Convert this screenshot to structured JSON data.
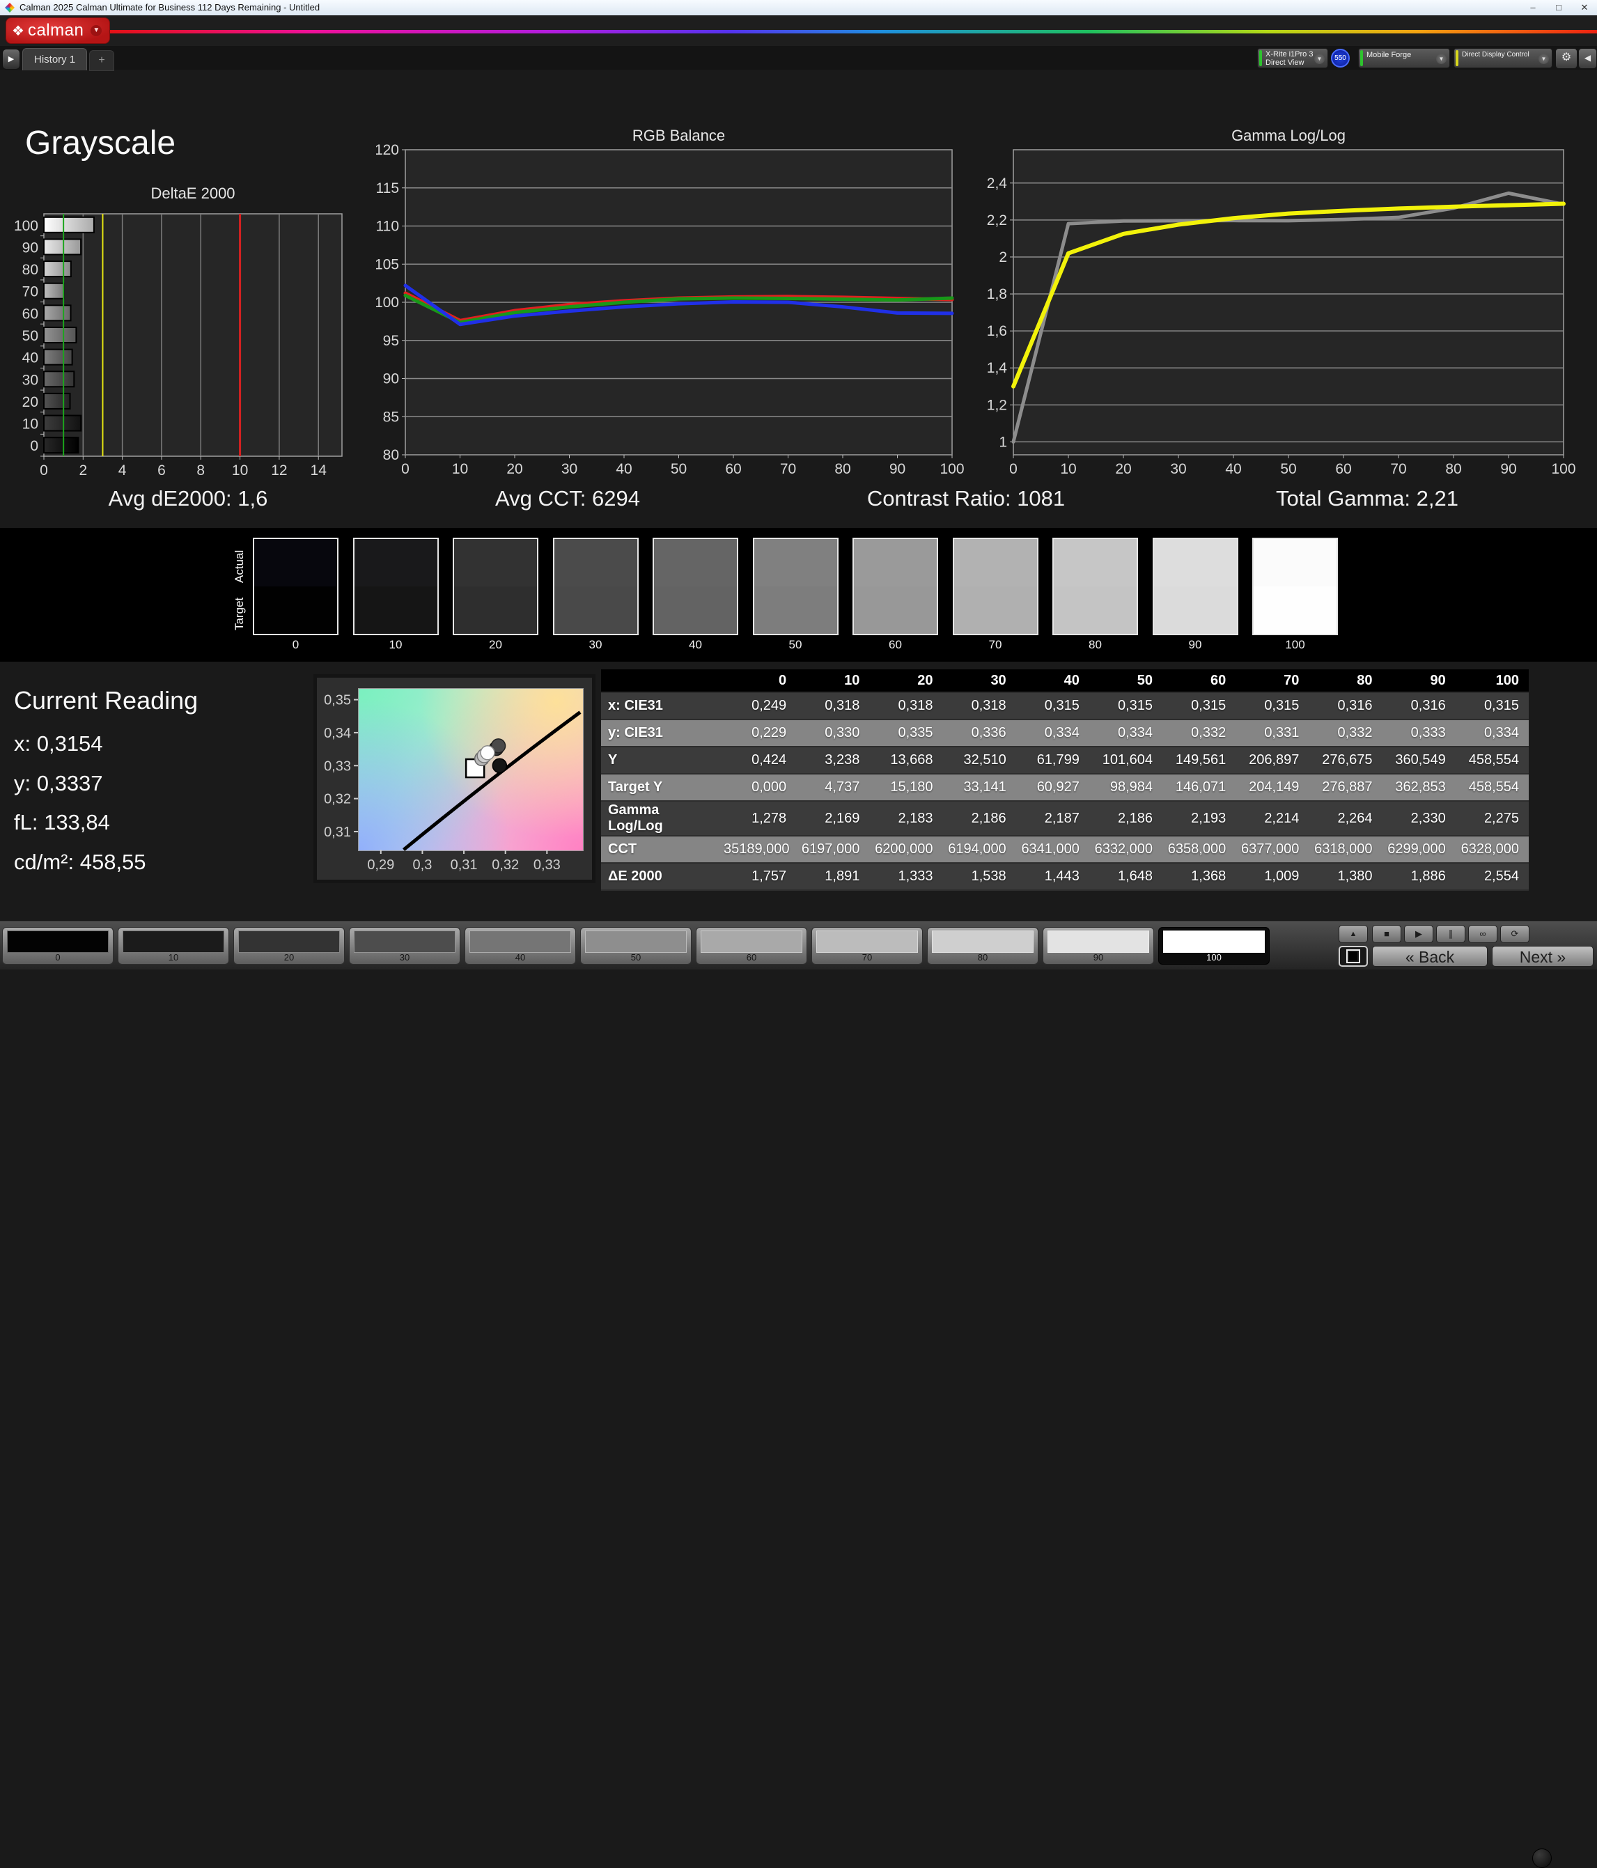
{
  "window": {
    "title": "Calman 2025 Calman Ultimate for Business 112 Days Remaining  - Untitled",
    "controls": {
      "minimize": "–",
      "maximize": "□",
      "close": "✕"
    }
  },
  "logo": {
    "wordmark": "calman",
    "diamond_icon": "❖",
    "caret": "▼"
  },
  "tabrow": {
    "scroll_icon": "▶",
    "history_tab": "History 1",
    "add_tab": "+",
    "meter": {
      "line1": "X-Rite i1Pro 3",
      "line2": "Direct View",
      "badge": "550",
      "stripe": "#2ec22e"
    },
    "source": {
      "label": "Mobile Forge",
      "stripe": "#2ec22e"
    },
    "display_control": {
      "label": "Direct Display Control",
      "stripe": "#d8d81c"
    },
    "gear_icon": "⚙",
    "collapse_icon": "◀"
  },
  "page": {
    "title": "Grayscale"
  },
  "summary": {
    "avg_de": "Avg dE2000: 1,6",
    "avg_cct": "Avg CCT: 6294",
    "contrast": "Contrast Ratio: 1081",
    "total_gamma": "Total Gamma: 2,21"
  },
  "chart_data": [
    {
      "type": "bar",
      "orientation": "horizontal",
      "title": "DeltaE 2000",
      "categories": [
        "100",
        "90",
        "80",
        "70",
        "60",
        "50",
        "40",
        "30",
        "20",
        "10",
        "0"
      ],
      "values": [
        2.554,
        1.886,
        1.38,
        1.009,
        1.368,
        1.648,
        1.443,
        1.538,
        1.333,
        1.891,
        1.757
      ],
      "levels": [
        100,
        90,
        80,
        70,
        60,
        50,
        40,
        30,
        20,
        10,
        0
      ],
      "xlim": [
        0,
        15.2
      ],
      "xticks": [
        {
          "v": 0,
          "label": "0"
        },
        {
          "v": 2,
          "label": "2"
        },
        {
          "v": 4,
          "label": "4"
        },
        {
          "v": 6,
          "label": "6"
        },
        {
          "v": 8,
          "label": "8"
        },
        {
          "v": 10,
          "label": "10"
        },
        {
          "v": 12,
          "label": "12"
        },
        {
          "v": 14,
          "label": "14"
        }
      ],
      "reference_lines": [
        {
          "v": 1,
          "color": "#1ca51c",
          "w": 2
        },
        {
          "v": 3,
          "color": "#e6e612",
          "w": 2
        },
        {
          "v": 10,
          "color": "#d42020",
          "w": 3
        }
      ],
      "grid": true
    },
    {
      "type": "line",
      "title": "RGB Balance",
      "x": [
        0,
        10,
        20,
        30,
        40,
        50,
        60,
        70,
        80,
        90,
        100
      ],
      "xlim": [
        0,
        100
      ],
      "xticks": [
        {
          "v": 0,
          "label": "0"
        },
        {
          "v": 10,
          "label": "10"
        },
        {
          "v": 20,
          "label": "20"
        },
        {
          "v": 30,
          "label": "30"
        },
        {
          "v": 40,
          "label": "40"
        },
        {
          "v": 50,
          "label": "50"
        },
        {
          "v": 60,
          "label": "60"
        },
        {
          "v": 70,
          "label": "70"
        },
        {
          "v": 80,
          "label": "80"
        },
        {
          "v": 90,
          "label": "90"
        },
        {
          "v": 100,
          "label": "100"
        }
      ],
      "ylim": [
        80,
        120
      ],
      "yticks": [
        {
          "v": 80,
          "label": "80"
        },
        {
          "v": 85,
          "label": "85"
        },
        {
          "v": 90,
          "label": "90"
        },
        {
          "v": 95,
          "label": "95"
        },
        {
          "v": 100,
          "label": "100"
        },
        {
          "v": 105,
          "label": "105"
        },
        {
          "v": 110,
          "label": "110"
        },
        {
          "v": 115,
          "label": "115"
        },
        {
          "v": 120,
          "label": "120"
        }
      ],
      "series": [
        {
          "name": "red",
          "color": "#e02020",
          "width": 5,
          "values": [
            101.2,
            97.6,
            98.9,
            99.7,
            100.2,
            100.55,
            100.7,
            100.75,
            100.65,
            100.5,
            100.35
          ]
        },
        {
          "name": "green",
          "color": "#189818",
          "width": 5,
          "values": [
            100.9,
            97.35,
            98.65,
            99.4,
            100.0,
            100.45,
            100.55,
            100.5,
            100.4,
            100.3,
            100.55
          ]
        },
        {
          "name": "blue",
          "color": "#2030e8",
          "width": 5,
          "values": [
            102.2,
            97.1,
            98.2,
            98.85,
            99.4,
            99.8,
            100.05,
            100.0,
            99.4,
            98.6,
            98.55
          ]
        }
      ]
    },
    {
      "type": "line",
      "title": "Gamma Log/Log",
      "x": [
        0,
        10,
        20,
        30,
        40,
        50,
        60,
        70,
        80,
        90,
        100
      ],
      "xlim": [
        0,
        100
      ],
      "xticks": [
        {
          "v": 0,
          "label": "0"
        },
        {
          "v": 10,
          "label": "10"
        },
        {
          "v": 20,
          "label": "20"
        },
        {
          "v": 30,
          "label": "30"
        },
        {
          "v": 40,
          "label": "40"
        },
        {
          "v": 50,
          "label": "50"
        },
        {
          "v": 60,
          "label": "60"
        },
        {
          "v": 70,
          "label": "70"
        },
        {
          "v": 80,
          "label": "80"
        },
        {
          "v": 90,
          "label": "90"
        },
        {
          "v": 100,
          "label": "100"
        }
      ],
      "ylim": [
        0.93,
        2.58
      ],
      "yticks": [
        {
          "v": 1,
          "label": "1"
        },
        {
          "v": 1.2,
          "label": "1,2"
        },
        {
          "v": 1.4,
          "label": "1,4"
        },
        {
          "v": 1.6,
          "label": "1,6"
        },
        {
          "v": 1.8,
          "label": "1,8"
        },
        {
          "v": 2,
          "label": "2"
        },
        {
          "v": 2.2,
          "label": "2,2"
        },
        {
          "v": 2.4,
          "label": "2,4"
        }
      ],
      "series": [
        {
          "name": "measured",
          "color": "#8d8d8d",
          "width": 5,
          "values": [
            1.0,
            2.18,
            2.195,
            2.196,
            2.197,
            2.196,
            2.203,
            2.214,
            2.264,
            2.345,
            2.285
          ]
        },
        {
          "name": "target",
          "color": "#f2f20a",
          "width": 6,
          "values": [
            1.3,
            2.02,
            2.125,
            2.175,
            2.21,
            2.235,
            2.25,
            2.262,
            2.272,
            2.28,
            2.288
          ]
        }
      ]
    },
    {
      "type": "scatter",
      "title": "CIE chromaticity",
      "xlim": [
        0.2845,
        0.3385
      ],
      "ylim": [
        0.3045,
        0.3535
      ],
      "xticks": [
        {
          "v": 0.29,
          "label": "0,29"
        },
        {
          "v": 0.3,
          "label": "0,3"
        },
        {
          "v": 0.31,
          "label": "0,31"
        },
        {
          "v": 0.32,
          "label": "0,32"
        },
        {
          "v": 0.33,
          "label": "0,33"
        }
      ],
      "yticks": [
        {
          "v": 0.31,
          "label": "0,31"
        },
        {
          "v": 0.32,
          "label": "0,32"
        },
        {
          "v": 0.33,
          "label": "0,33"
        },
        {
          "v": 0.34,
          "label": "0,34"
        },
        {
          "v": 0.35,
          "label": "0,35"
        }
      ],
      "locus": {
        "from": [
          0.2955,
          0.3045
        ],
        "ctrl": [
          0.3175,
          0.3272
        ],
        "to": [
          0.338,
          0.3462
        ]
      },
      "target_square": {
        "x": 0.3127,
        "y": 0.3292
      },
      "points": [
        {
          "x": 0.3186,
          "y": 0.33,
          "fill": "#151515",
          "stroke": "#000"
        },
        {
          "x": 0.3178,
          "y": 0.3352,
          "fill": "#383838,",
          "stroke": "#111"
        },
        {
          "x": 0.3183,
          "y": 0.336,
          "fill": "#4a4a4a",
          "stroke": "#222"
        },
        {
          "x": 0.3143,
          "y": 0.3321,
          "fill": "#b8b8b8",
          "stroke": "#666"
        },
        {
          "x": 0.3149,
          "y": 0.333,
          "fill": "#cfcfcf",
          "stroke": "#777"
        },
        {
          "x": 0.3157,
          "y": 0.3339,
          "fill": "#fdfdfd",
          "stroke": "#888"
        }
      ]
    }
  ],
  "grayscale_strip": {
    "row_labels": [
      "Actual",
      "Target"
    ],
    "steps": [
      {
        "label": "0",
        "actual": "#07070d",
        "target": "#010101"
      },
      {
        "label": "10",
        "actual": "#19191b",
        "target": "#151515"
      },
      {
        "label": "20",
        "actual": "#323232",
        "target": "#2e2e2e"
      },
      {
        "label": "30",
        "actual": "#4b4b4b",
        "target": "#494949"
      },
      {
        "label": "40",
        "actual": "#656565",
        "target": "#636363"
      },
      {
        "label": "50",
        "actual": "#808080",
        "target": "#7d7d7d"
      },
      {
        "label": "60",
        "actual": "#9a9a9a",
        "target": "#989898"
      },
      {
        "label": "70",
        "actual": "#b2b2b2",
        "target": "#b0b0b0"
      },
      {
        "label": "80",
        "actual": "#c6c6c6",
        "target": "#c4c4c4"
      },
      {
        "label": "90",
        "actual": "#dddddd",
        "target": "#dbdbdb"
      },
      {
        "label": "100",
        "actual": "#fbfbfb",
        "target": "#fefefe"
      }
    ]
  },
  "current_reading": {
    "title": "Current Reading",
    "lines": [
      "x: 0,3154",
      "y: 0,3337",
      "fL: 133,84",
      "cd/m²: 458,55"
    ]
  },
  "table": {
    "columns": [
      "0",
      "10",
      "20",
      "30",
      "40",
      "50",
      "60",
      "70",
      "80",
      "90",
      "100"
    ],
    "rows": [
      {
        "label": "x: CIE31",
        "values": [
          "0,249",
          "0,318",
          "0,318",
          "0,318",
          "0,315",
          "0,315",
          "0,315",
          "0,315",
          "0,316",
          "0,316",
          "0,315"
        ]
      },
      {
        "label": "y: CIE31",
        "values": [
          "0,229",
          "0,330",
          "0,335",
          "0,336",
          "0,334",
          "0,334",
          "0,332",
          "0,331",
          "0,332",
          "0,333",
          "0,334"
        ]
      },
      {
        "label": "Y",
        "values": [
          "0,424",
          "3,238",
          "13,668",
          "32,510",
          "61,799",
          "101,604",
          "149,561",
          "206,897",
          "276,675",
          "360,549",
          "458,554"
        ]
      },
      {
        "label": "Target Y",
        "values": [
          "0,000",
          "4,737",
          "15,180",
          "33,141",
          "60,927",
          "98,984",
          "146,071",
          "204,149",
          "276,887",
          "362,853",
          "458,554"
        ]
      },
      {
        "label": "Gamma Log/Log",
        "values": [
          "1,278",
          "2,169",
          "2,183",
          "2,186",
          "2,187",
          "2,186",
          "2,193",
          "2,214",
          "2,264",
          "2,330",
          "2,275"
        ]
      },
      {
        "label": "CCT",
        "values": [
          "35189,000",
          "6197,000",
          "6200,000",
          "6194,000",
          "6341,000",
          "6332,000",
          "6358,000",
          "6377,000",
          "6318,000",
          "6299,000",
          "6328,000"
        ]
      },
      {
        "label": "ΔE 2000",
        "values": [
          "1,757",
          "1,891",
          "1,333",
          "1,538",
          "1,443",
          "1,648",
          "1,368",
          "1,009",
          "1,380",
          "1,886",
          "2,554"
        ]
      }
    ]
  },
  "bottom_bar": {
    "patches": [
      {
        "label": "0",
        "color": "#030303",
        "selected": false
      },
      {
        "label": "10",
        "color": "#1b1b1b",
        "selected": false
      },
      {
        "label": "20",
        "color": "#333333",
        "selected": false
      },
      {
        "label": "30",
        "color": "#4d4d4d",
        "selected": false
      },
      {
        "label": "40",
        "color": "#757575",
        "selected": false
      },
      {
        "label": "50",
        "color": "#8e8e8e",
        "selected": false
      },
      {
        "label": "60",
        "color": "#a9a9a9",
        "selected": false
      },
      {
        "label": "70",
        "color": "#bcbcbc",
        "selected": false
      },
      {
        "label": "80",
        "color": "#cfcfcf",
        "selected": false
      },
      {
        "label": "90",
        "color": "#e3e3e3",
        "selected": false
      },
      {
        "label": "100",
        "color": "#ffffff",
        "selected": true
      }
    ],
    "transport": [
      {
        "name": "stop-icon",
        "glyph": "■"
      },
      {
        "name": "play-icon",
        "glyph": "▶"
      },
      {
        "name": "step-icon",
        "glyph": "∥"
      },
      {
        "name": "continuous-icon",
        "glyph": "∞"
      },
      {
        "name": "loop-icon",
        "glyph": "⟳"
      }
    ],
    "up_icon": "▲",
    "back_label": "« Back",
    "next_label": "Next »"
  }
}
